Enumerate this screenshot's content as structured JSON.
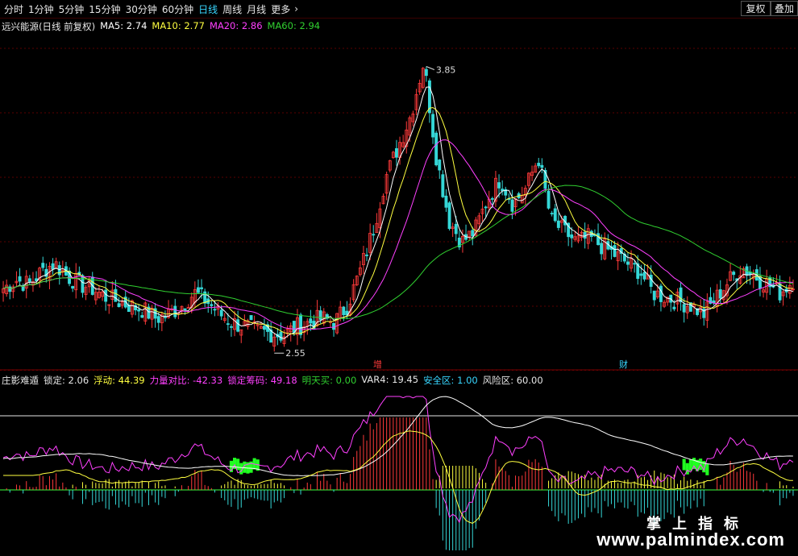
{
  "toolbar": {
    "periods": [
      "分时",
      "1分钟",
      "5分钟",
      "15分钟",
      "30分钟",
      "60分钟",
      "日线",
      "周线",
      "月线",
      "更多"
    ],
    "active_period": "日线",
    "restore_rights": "复权",
    "overlay": "叠加"
  },
  "main_legend": {
    "name": "远兴能源(日线 前复权)",
    "ma5": "MA5: 2.74",
    "ma10": "MA10: 2.77",
    "ma20": "MA20: 2.86",
    "ma60": "MA60: 2.94"
  },
  "indicator_legend": {
    "name": "庄影难遁",
    "lock": "锁定: 2.06",
    "float": "浮动: 44.39",
    "force_ratio": "力量对比: -42.33",
    "lock_chips": "锁定筹码: 49.18",
    "buy_tomorrow": "明天买: 0.00",
    "var4": "VAR4: 19.45",
    "safe_zone": "安全区: 1.00",
    "risk_zone": "风险区: 60.00"
  },
  "markers": {
    "zeng": "增",
    "cai": "财"
  },
  "watermark": {
    "cn": "掌上指标",
    "url": "www.palmindex.com"
  },
  "colors": {
    "up": "#ff3a3a",
    "down": "#35d7d7",
    "ma5": "#ffffff",
    "ma10": "#ffff40",
    "ma20": "#ff40ff",
    "ma60": "#30d030",
    "bg": "#000000",
    "grid": "#5a0000"
  },
  "chart_data": {
    "type": "candlestick",
    "high_label": "3.85",
    "low_label": "2.55",
    "ma5": 2.74,
    "ma10": 2.77,
    "ma20": 2.86,
    "ma60": 2.94,
    "path": [
      2.78,
      2.82,
      2.8,
      2.86,
      2.9,
      2.84,
      2.8,
      2.78,
      2.74,
      2.72,
      2.7,
      2.68,
      2.64,
      2.66,
      2.7,
      2.76,
      2.72,
      2.66,
      2.62,
      2.6,
      2.58,
      2.57,
      2.56,
      2.6,
      2.62,
      2.64,
      2.62,
      2.7,
      2.86,
      3.05,
      3.3,
      3.45,
      3.6,
      3.85,
      3.4,
      3.1,
      3.0,
      3.05,
      3.2,
      3.3,
      3.18,
      3.25,
      3.4,
      3.1,
      3.05,
      3.0,
      3.02,
      2.98,
      2.94,
      2.9,
      2.86,
      2.76,
      2.74,
      2.72,
      2.7,
      2.66,
      2.74,
      2.82,
      2.88,
      2.84,
      2.8,
      2.76,
      2.82
    ]
  }
}
